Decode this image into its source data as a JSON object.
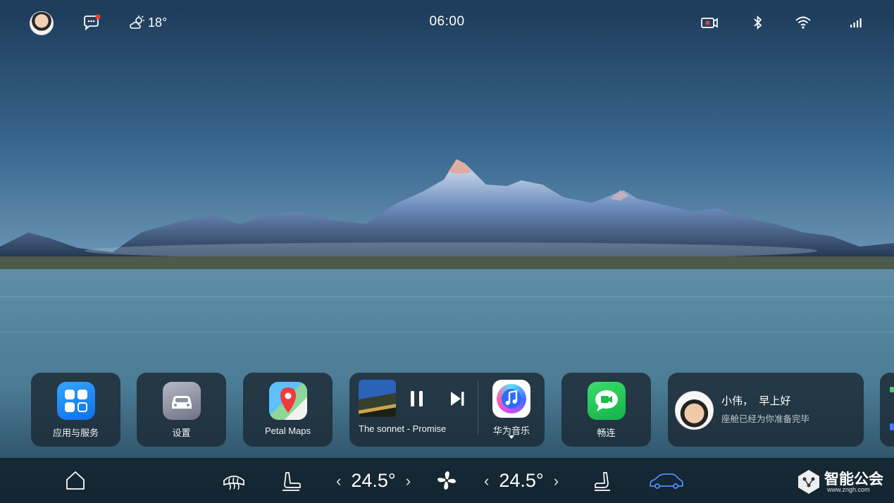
{
  "status_bar": {
    "avatar_icon": "user-avatar",
    "message_icon": "chat-bubble-icon",
    "message_badge": true,
    "weather_icon": "sun-cloud-icon",
    "temperature": "18°",
    "time": "06:00",
    "right_icons": [
      "dashcam-record-icon",
      "bluetooth-icon",
      "wifi-icon",
      "signal-icon"
    ]
  },
  "dock": {
    "apps_label": "应用与服务",
    "settings_label": "设置",
    "maps_label": "Petal Maps",
    "media": {
      "track": "The sonnet - Promise",
      "playing": true,
      "app_label": "华为音乐"
    },
    "changlian_label": "畅连",
    "greeting": {
      "name": "小伟，  早上好",
      "subtitle": "座舱已经为你准备完毕"
    }
  },
  "nav_bar": {
    "left_temp": "24.5°",
    "right_temp": "24.5°",
    "icons": [
      "home-icon",
      "defrost-icon",
      "seat-heat-icon",
      "fan-icon",
      "seat-icon",
      "car-icon"
    ],
    "accent": "#4c8dff"
  },
  "watermark": {
    "text": "智能公会",
    "url": "www.zngh.com"
  }
}
